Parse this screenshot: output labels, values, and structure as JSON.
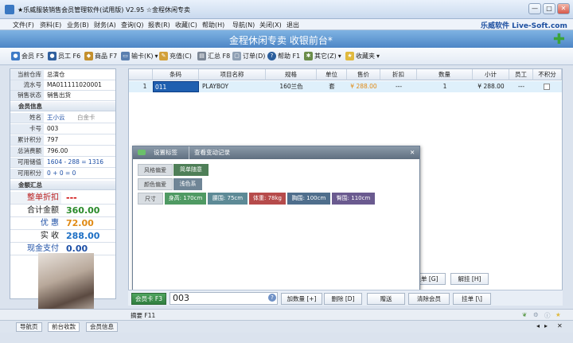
{
  "window": {
    "title": "★乐威服装销售会员管理软件(试用版) V2.95 ☆金程休闲专卖",
    "min": "—",
    "max": "□",
    "close": "✕"
  },
  "menu": [
    "文件(F)",
    "资料(E)",
    "业务(B)",
    "财务(A)",
    "查询(Q)",
    "报表(R)",
    "收藏(C)",
    "帮助(H)",
    "导航(N)",
    "关闭(X)",
    "退出"
  ],
  "brand": "乐威软件 Live-Soft.com",
  "banner": "金程休闲专卖  收银前台*",
  "toolbar": [
    "会员 F5",
    "员工 F6",
    "商品 F7",
    "输卡(K)",
    "充值(C)",
    "汇总 F8",
    "订单(D)",
    "帮助 F1",
    "其它(Z)",
    "收藏夹"
  ],
  "left": {
    "rows1": [
      {
        "k": "当前仓库",
        "v": "总演仓"
      },
      {
        "k": "流水号",
        "v": "MA011111020001"
      },
      {
        "k": "销售状态",
        "v": "销售出货"
      }
    ],
    "member_title": "会员信息",
    "member": [
      {
        "k": "姓名",
        "v": "王小云",
        "v2": "白金卡"
      },
      {
        "k": "卡号",
        "v": "003"
      },
      {
        "k": "累计积分",
        "v": "797"
      },
      {
        "k": "总消费额",
        "v": "796.00"
      },
      {
        "k": "可用储值",
        "v": "1604 - 288 = 1316"
      },
      {
        "k": "可用积分",
        "v": "0 + 0 = 0"
      }
    ],
    "sum_title": "金额汇总",
    "sums": [
      {
        "k": "整单折扣",
        "v": "---"
      },
      {
        "k": "合计金额",
        "v": "360.00"
      },
      {
        "k": "优  惠",
        "v": "72.00"
      },
      {
        "k": "实  收",
        "v": "288.00"
      },
      {
        "k": "现金支付",
        "v": "0.00"
      }
    ]
  },
  "grid": {
    "headers": [
      "",
      "条码",
      "项目名称",
      "规格",
      "单位",
      "售价",
      "折扣",
      "数量",
      "小计",
      "员工",
      "不积分"
    ],
    "row": [
      "1",
      "011",
      "PLAYBOY",
      "160兰色",
      "套",
      "¥ 288.00",
      "---",
      "1",
      "¥ 288.00",
      "---",
      ""
    ]
  },
  "dialog": {
    "tabs": [
      "设置标签",
      "查看变动记录"
    ],
    "close": "✕",
    "style_label": "风格偏爱",
    "style_val": "简单随意",
    "color_label": "颜色偏爱",
    "color_val": "浅色系",
    "size_label": "尺寸",
    "sizes": [
      "身高: 170cm",
      "腰围: 75cm",
      "体重: 78kg",
      "胸围: 100cm",
      "臀围: 110cm"
    ],
    "colors": {
      "header": "#6d7d8f",
      "green": "#4f9a63",
      "gray": "#8e979f"
    }
  },
  "bottom": {
    "member_btn": "会员卡 F3",
    "member_input": "003",
    "buttons": [
      "加数量 [+]",
      "删除 [D]",
      "赠送",
      "清除会员",
      "挂单 [\\]"
    ],
    "top_buttons": [
      "挂单 [G]",
      "解挂 [H]"
    ]
  },
  "status": {
    "hint": "摘要  F11"
  },
  "tabs": [
    "导航页",
    "前台收款",
    "会员信息"
  ]
}
